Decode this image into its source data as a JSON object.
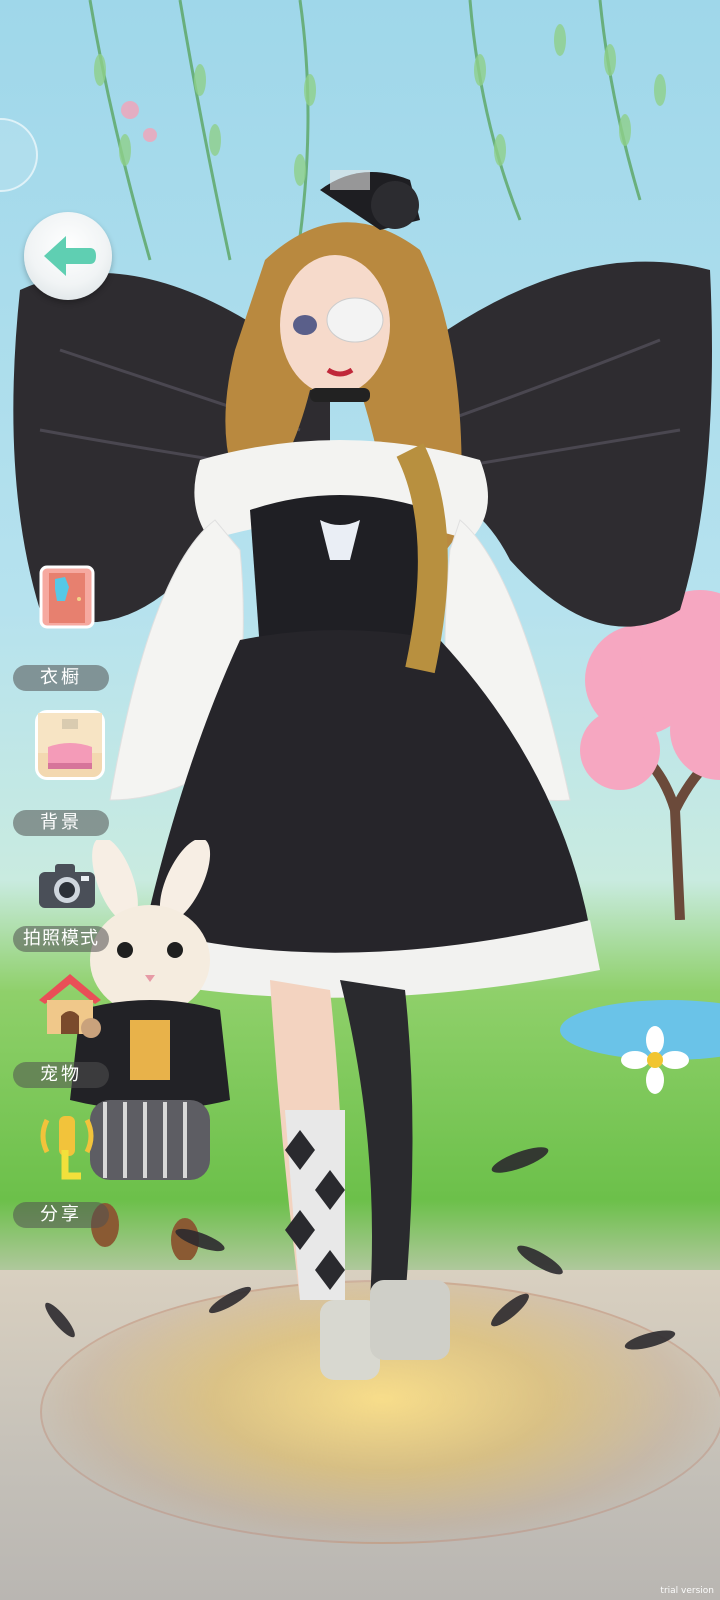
{
  "menu": {
    "wardrobe_label": "衣橱",
    "background_label": "背景",
    "photo_label": "拍照模式",
    "pet_label": "宠物",
    "share_label": "分享"
  },
  "icons": {
    "back": "back-arrow-icon",
    "wardrobe": "wardrobe-icon",
    "background": "background-room-icon",
    "photo": "camera-icon",
    "pet": "doghouse-icon",
    "share": "share-signal-icon"
  },
  "colors": {
    "back_arrow": "#5fcfb2",
    "label_bg": "#5a5a5a",
    "sky": "#9fd7ea",
    "grass": "#6cc04a"
  },
  "watermark": "trial version"
}
